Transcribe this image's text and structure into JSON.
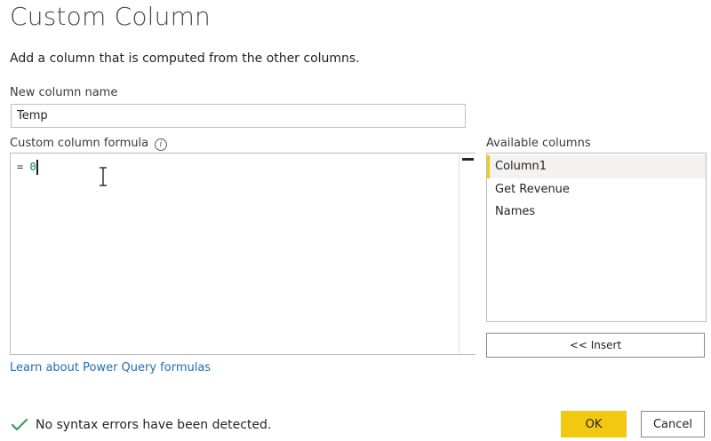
{
  "dialog": {
    "title": "Custom Column",
    "subtitle": "Add a column that is computed from the other columns."
  },
  "new_column": {
    "label": "New column name",
    "value": "Temp"
  },
  "formula": {
    "label": "Custom column formula",
    "info_icon": "info-icon",
    "prefix": "= ",
    "value": "0"
  },
  "available_columns": {
    "label": "Available columns",
    "items": [
      "Column1",
      "Get Revenue",
      "Names"
    ],
    "selected_index": 0
  },
  "insert_button": "<< Insert",
  "learn_link": "Learn about Power Query formulas",
  "status": {
    "icon": "checkmark-icon",
    "text": "No syntax errors have been detected."
  },
  "buttons": {
    "ok": "OK",
    "cancel": "Cancel"
  },
  "colors": {
    "accent": "#f2c811",
    "link": "#1e6fb8",
    "success": "#3a9a5b"
  }
}
